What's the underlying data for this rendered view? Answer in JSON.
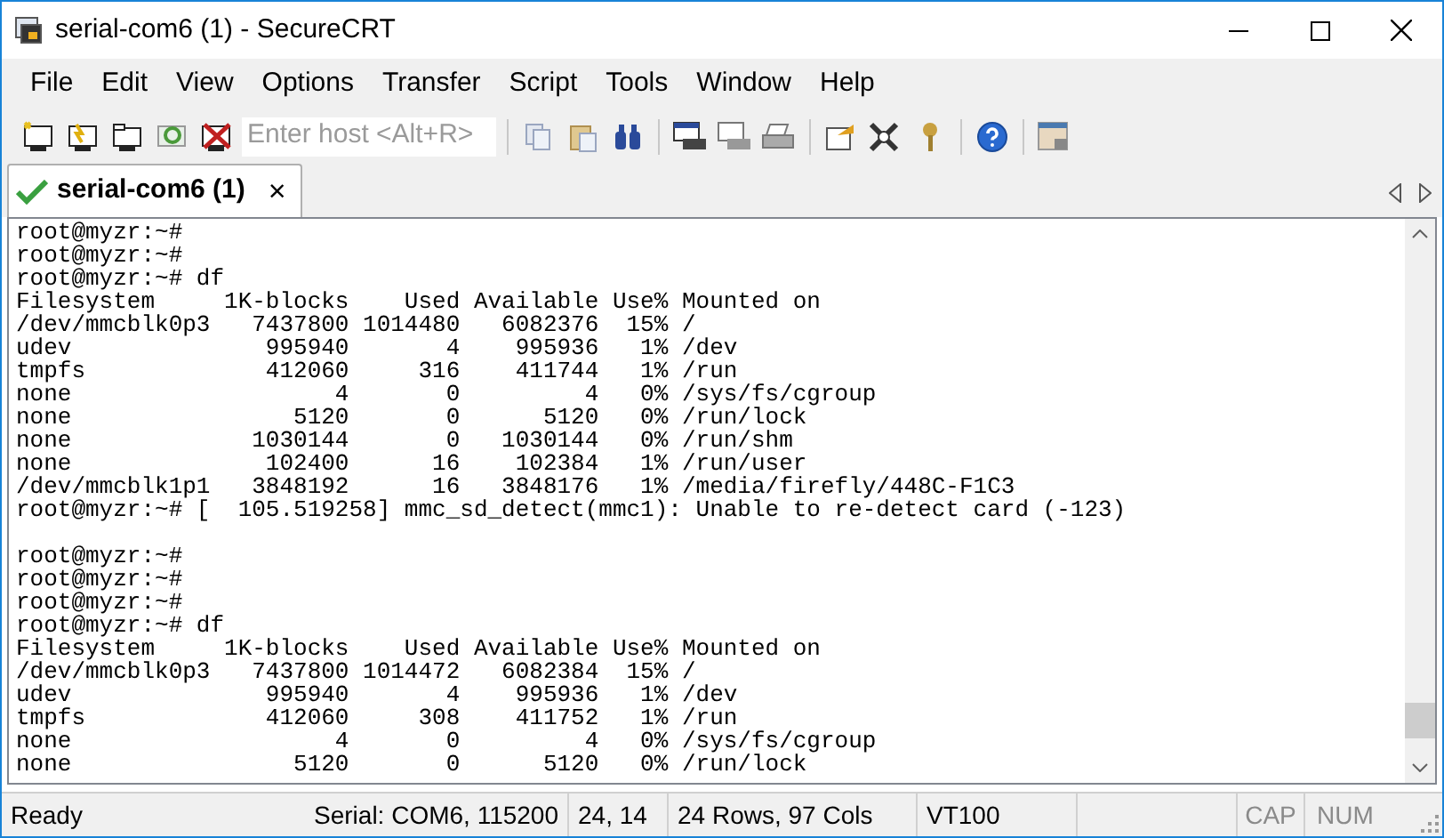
{
  "window": {
    "title": "serial-com6 (1) - SecureCRT"
  },
  "menu": [
    "File",
    "Edit",
    "View",
    "Options",
    "Transfer",
    "Script",
    "Tools",
    "Window",
    "Help"
  ],
  "toolbar": {
    "host_field": {
      "placeholder": "Enter host <Alt+R>"
    }
  },
  "tabs": [
    {
      "label": "serial-com6 (1)",
      "selected": true,
      "connected": true,
      "close": "×"
    }
  ],
  "terminal": {
    "lines": [
      {
        "kind": "text",
        "text": "root@myzr:~#"
      },
      {
        "kind": "text",
        "text": "root@myzr:~#"
      },
      {
        "kind": "text",
        "text": "root@myzr:~# df"
      },
      {
        "kind": "text",
        "text": "Filesystem     1K-blocks    Used Available Use% Mounted on"
      },
      {
        "kind": "text",
        "text": "/dev/mmcblk0p3   7437800 1014480   6082376  15% /"
      },
      {
        "kind": "text",
        "text": "udev              995940       4    995936   1% /dev"
      },
      {
        "kind": "text",
        "text": "tmpfs             412060     316    411744   1% /run"
      },
      {
        "kind": "text",
        "text": "none                   4       0         4   0% /sys/fs/cgroup"
      },
      {
        "kind": "text",
        "text": "none                5120       0      5120   0% /run/lock"
      },
      {
        "kind": "text",
        "text": "none             1030144       0   1030144   0% /run/shm"
      },
      {
        "kind": "text",
        "text": "none              102400      16    102384   1% /run/user"
      },
      {
        "kind": "text",
        "text": "/dev/mmcblk1p1   3848192      16   3848176   1% /media/firefly/448C-F1C3"
      },
      {
        "kind": "text",
        "text": "root@myzr:~# [  105.519258] mmc_sd_detect(mmc1): Unable to re-detect card (-123)"
      },
      {
        "kind": "blank"
      },
      {
        "kind": "text",
        "text": "root@myzr:~#"
      },
      {
        "kind": "text",
        "text": "root@myzr:~#"
      },
      {
        "kind": "text",
        "text": "root@myzr:~#"
      },
      {
        "kind": "text",
        "text": "root@myzr:~# df"
      },
      {
        "kind": "text",
        "text": "Filesystem     1K-blocks    Used Available Use% Mounted on"
      },
      {
        "kind": "text",
        "text": "/dev/mmcblk0p3   7437800 1014472   6082384  15% /"
      },
      {
        "kind": "text",
        "text": "udev              995940       4    995936   1% /dev"
      },
      {
        "kind": "text",
        "text": "tmpfs             412060     308    411752   1% /run"
      },
      {
        "kind": "text",
        "text": "none                   4       0         4   0% /sys/fs/cgroup"
      },
      {
        "kind": "text",
        "text": "none                5120       0      5120   0% /run/lock"
      }
    ]
  },
  "status_bar": {
    "fields": [
      {
        "kind": "text",
        "text": "Ready"
      },
      {
        "kind": "text",
        "text": "Serial: COM6, 115200"
      },
      {
        "kind": "text",
        "text": "24,  14"
      },
      {
        "kind": "text",
        "text": "24 Rows, 97 Cols"
      },
      {
        "kind": "text",
        "text": "VT100"
      },
      {
        "kind": "empty"
      },
      {
        "kind": "indicator",
        "text": "CAP",
        "on": false
      },
      {
        "kind": "indicator",
        "text": "NUM",
        "on": false
      }
    ]
  }
}
